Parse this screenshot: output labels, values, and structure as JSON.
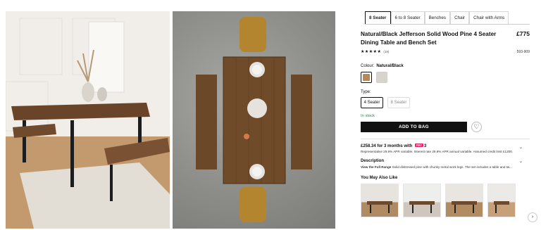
{
  "tabs": [
    {
      "label": "8 Seater",
      "active": true
    },
    {
      "label": "6 to 8 Seater",
      "active": false
    },
    {
      "label": "Benches",
      "active": false
    },
    {
      "label": "Chair",
      "active": false
    },
    {
      "label": "Chair with Arms",
      "active": false
    }
  ],
  "product": {
    "title": "Natural/Black Jefferson Solid Wood Pine 4 Seater Dining Table and Bench Set",
    "price": "£775",
    "rating_stars": "★★★★★",
    "rating_value": 4.5,
    "review_count": "(19)",
    "sku": "593-909"
  },
  "colour": {
    "label": "Colour:",
    "selected": "Natural/Black",
    "swatch_colors": [
      "#b5895c",
      "#d7d3cf"
    ]
  },
  "type": {
    "label": "Type:",
    "options": [
      {
        "label": "4 Seater",
        "selected": true
      },
      {
        "label": "8 Seater",
        "selected": false
      }
    ]
  },
  "stock": "In stock",
  "add_to_bag": "ADD TO BAG",
  "finance": {
    "headline": "£258.34 for 3 months with",
    "brand": "PAY",
    "brand_num": "3",
    "details": "Representative 29.9% APR variable. Interest rate 29.9% APR annual variable. Assumed credit limit £1200."
  },
  "description": {
    "heading": "Description",
    "link": "View the Full Range",
    "text": " Solid distressed pine with chunky metal work legs. The set includes a table and tw..."
  },
  "recommendations": {
    "heading": "You May Also Like",
    "count": 4
  },
  "icons": {
    "heart": "heart-icon",
    "chevron": "chevron-down-icon",
    "next": "chevron-right-icon"
  }
}
